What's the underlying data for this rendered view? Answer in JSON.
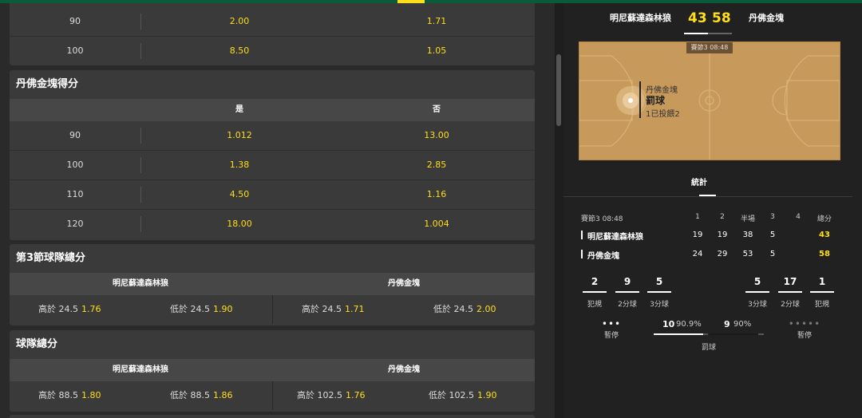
{
  "topmarket": {
    "rows": [
      {
        "line": "90",
        "over": "2.00",
        "under": "1.71"
      },
      {
        "line": "100",
        "over": "8.50",
        "under": "1.05"
      }
    ]
  },
  "nuggets_points": {
    "title": "丹佛金塊得分",
    "yes_label": "是",
    "no_label": "否",
    "rows": [
      {
        "line": "90",
        "yes": "1.012",
        "no": "13.00"
      },
      {
        "line": "100",
        "yes": "1.38",
        "no": "2.85"
      },
      {
        "line": "110",
        "yes": "4.50",
        "no": "1.16"
      },
      {
        "line": "120",
        "yes": "18.00",
        "no": "1.004"
      }
    ]
  },
  "q3_team_total": {
    "title": "第3節球隊總分",
    "team1": "明尼蘇達森林狼",
    "team2": "丹佛金塊",
    "cells": [
      {
        "label": "高於 24.5",
        "odds": "1.76"
      },
      {
        "label": "低於 24.5",
        "odds": "1.90"
      },
      {
        "label": "高於 24.5",
        "odds": "1.71"
      },
      {
        "label": "低於 24.5",
        "odds": "2.00"
      }
    ]
  },
  "team_total": {
    "title": "球隊總分",
    "team1": "明尼蘇達森林狼",
    "team2": "丹佛金塊",
    "cells": [
      {
        "label": "高於 88.5",
        "odds": "1.80"
      },
      {
        "label": "低於 88.5",
        "odds": "1.86"
      },
      {
        "label": "高於 102.5",
        "odds": "1.76"
      },
      {
        "label": "低於 102.5",
        "odds": "1.90"
      }
    ]
  },
  "match": {
    "home": "明尼蘇達森林狼",
    "away": "丹佛金塊",
    "home_score": "43",
    "away_score": "58",
    "quarter_badge": "賽節3  08:48",
    "event_team": "丹佛金塊",
    "event_type": "罰球",
    "event_detail": "1已投餵2"
  },
  "stats": {
    "tab_label": "統計",
    "period_label": "賽節3  08:48",
    "cols": [
      "1",
      "2",
      "半場",
      "3",
      "4",
      "總分"
    ],
    "home_row": {
      "q1": "19",
      "q2": "19",
      "half": "38",
      "q3": "5",
      "q4": "",
      "total": "43"
    },
    "away_row": {
      "q1": "24",
      "q2": "29",
      "half": "53",
      "q3": "5",
      "q4": "",
      "total": "58"
    },
    "home_box": [
      {
        "value": "2",
        "label": "犯規"
      },
      {
        "value": "9",
        "label": "2分球"
      },
      {
        "value": "5",
        "label": "3分球"
      }
    ],
    "away_box": [
      {
        "value": "5",
        "label": "3分球"
      },
      {
        "value": "17",
        "label": "2分球"
      },
      {
        "value": "1",
        "label": "犯規"
      }
    ],
    "timeouts_label_home": "暫停",
    "timeouts_label_away": "暫停",
    "ft_home_made": "10",
    "ft_home_pct": "90.9%",
    "ft_away_made": "9",
    "ft_away_pct": "90%",
    "ft_label": "罰球",
    "ft_home_fraction": 0.909,
    "ft_away_fraction": 0.9
  },
  "colors": {
    "accent": "#ffdf1b",
    "brand_green": "#0a5a3c"
  }
}
